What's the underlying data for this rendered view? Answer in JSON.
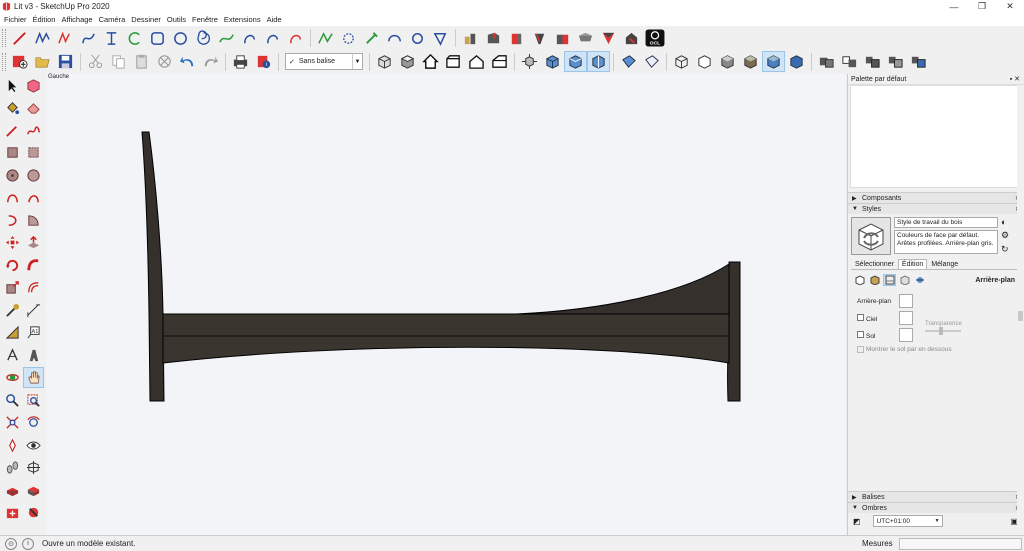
{
  "window": {
    "title": "Lit v3 - SketchUp Pro 2020",
    "controls": {
      "minimize": "—",
      "maximize": "❐",
      "close": "✕"
    }
  },
  "menu": [
    "Fichier",
    "Édition",
    "Affichage",
    "Caméra",
    "Dessiner",
    "Outils",
    "Fenêtre",
    "Extensions",
    "Aide"
  ],
  "toolbar1": {
    "icons": [
      "line-icon",
      "freehand-icon",
      "arc-icon",
      "arc-2pt-icon",
      "rectangle-icon",
      "circle-icon",
      "polygon-icon",
      "freehand-curve-icon",
      "bezier-icon",
      "pie-icon",
      "rotated-rectangle-icon",
      "follow-me-icon",
      "offset-icon",
      "tape-icon",
      "curve-icon",
      "spline-icon",
      "extension-1-icon",
      "extension-2-icon",
      "extension-3-icon",
      "extension-4-icon",
      "extension-5-icon",
      "extension-6-icon",
      "extension-7-icon",
      "extension-8-icon",
      "ocl-icon"
    ],
    "ocl_label": "OCL"
  },
  "toolbar2": {
    "tag_selector": {
      "check": "✓",
      "value": "Sans balise"
    },
    "icons_left": [
      "new-model-icon",
      "open-icon",
      "save-icon",
      "cut-icon",
      "copy-icon",
      "paste-icon",
      "erase-icon",
      "undo-icon",
      "redo-icon",
      "print-icon",
      "model-info-icon"
    ],
    "views": [
      "iso-icon",
      "top-icon",
      "front-icon",
      "right-icon",
      "back-icon",
      "left-icon",
      "zoom-extents-icon",
      "perspective-icon",
      "section-plane-icon",
      "section-fill-icon",
      "xray-icon",
      "back-edges-icon",
      "wireframe-icon",
      "hidden-line-icon",
      "shaded-icon",
      "shaded-textures-icon",
      "monochrome-icon",
      "component-1-icon",
      "component-2-icon",
      "component-3-icon",
      "component-4-icon",
      "component-5-icon"
    ]
  },
  "viewport": {
    "scene_label": "Gauche",
    "colors": {
      "background": "#f3f4f8",
      "wood": "#35302b",
      "edge": "#000000"
    }
  },
  "tray": {
    "title": "Palette par défaut",
    "sections": {
      "composants": "Composants",
      "styles": "Styles",
      "balises": "Balises",
      "ombres": "Ombres"
    },
    "styles": {
      "name": "Style de travail du bois",
      "description": "Couleurs de face par défaut. Arêtes profilées. Arrière-plan gris.",
      "tabs": [
        "Sélectionner",
        "Édition",
        "Mélange"
      ],
      "active_tab": "Édition",
      "edit_section": "Arrière-plan",
      "background_label": "Arrière-plan",
      "sky_label": "Ciel",
      "ground_label": "Sol",
      "transparency_label": "Transparence",
      "show_ground_below": "Montrer le sol par en dessous"
    },
    "shadows": {
      "timezone": "UTC+01:00"
    }
  },
  "status": {
    "message": "Ouvre un modèle existant.",
    "measurements_label": "Mesures",
    "measurements_value": ""
  }
}
